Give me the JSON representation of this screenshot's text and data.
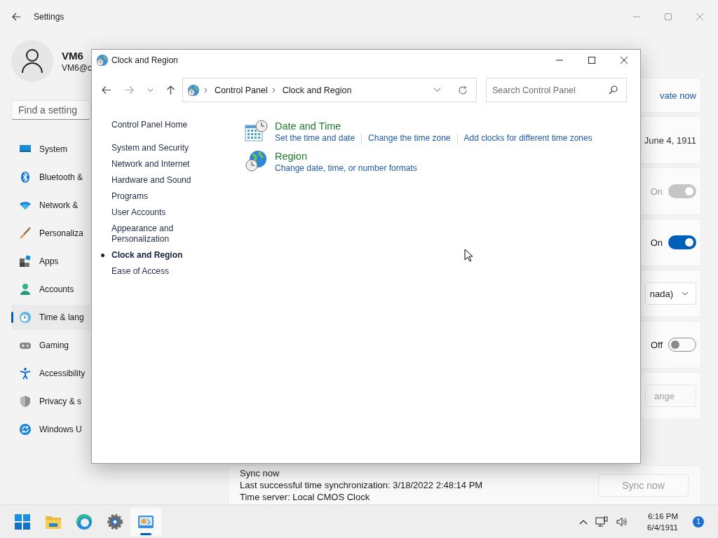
{
  "settings": {
    "title": "Settings",
    "user": {
      "name": "VM6",
      "email": "VM6@c"
    },
    "search": {
      "placeholder": "Find a setting"
    },
    "nav": [
      {
        "label": "System",
        "selected": false
      },
      {
        "label": "Bluetooth &",
        "selected": false
      },
      {
        "label": "Network &",
        "selected": false
      },
      {
        "label": "Personaliza",
        "selected": false
      },
      {
        "label": "Apps",
        "selected": false
      },
      {
        "label": "Accounts",
        "selected": false
      },
      {
        "label": "Time & lang",
        "selected": true
      },
      {
        "label": "Gaming",
        "selected": false
      },
      {
        "label": "Accessibility",
        "selected": false
      },
      {
        "label": "Privacy & s",
        "selected": false
      },
      {
        "label": "Windows U",
        "selected": false
      }
    ],
    "cards": [
      {
        "kind": "link",
        "text": "vate now"
      },
      {
        "kind": "text",
        "text": "June 4, 1911"
      },
      {
        "kind": "toggle",
        "text": "On",
        "on": true,
        "disabled": true
      },
      {
        "kind": "toggle",
        "text": "On",
        "on": true,
        "disabled": false
      },
      {
        "kind": "dropdown",
        "text": "nada)"
      },
      {
        "kind": "toggle",
        "text": "Off",
        "on": false,
        "disabled": false
      },
      {
        "kind": "button",
        "text": "ange",
        "disabled": true
      }
    ],
    "sync": {
      "title": "Sync now",
      "lines": [
        "Last successful time synchronization: 3/18/2022 2:48:14 PM",
        "Time server: Local CMOS Clock"
      ],
      "button": "Sync now",
      "button_disabled": true
    }
  },
  "control_panel": {
    "title": "Clock and Region",
    "breadcrumb": [
      "Control Panel",
      "Clock and Region"
    ],
    "search": {
      "placeholder": "Search Control Panel"
    },
    "sidebar": {
      "home": "Control Panel Home",
      "items": [
        {
          "label": "System and Security",
          "selected": false
        },
        {
          "label": "Network and Internet",
          "selected": false
        },
        {
          "label": "Hardware and Sound",
          "selected": false
        },
        {
          "label": "Programs",
          "selected": false
        },
        {
          "label": "User Accounts",
          "selected": false
        },
        {
          "label": "Appearance and Personalization",
          "selected": false
        },
        {
          "label": "Clock and Region",
          "selected": true
        },
        {
          "label": "Ease of Access",
          "selected": false
        }
      ]
    },
    "categories": [
      {
        "title": "Date and Time",
        "links": [
          "Set the time and date",
          "Change the time zone",
          "Add clocks for different time zones"
        ]
      },
      {
        "title": "Region",
        "links": [
          "Change date, time, or number formats"
        ]
      }
    ]
  },
  "taskbar": {
    "apps": [
      {
        "selected": false
      },
      {
        "selected": false
      },
      {
        "selected": false
      },
      {
        "selected": false
      },
      {
        "selected": true
      }
    ],
    "time": "6:16 PM",
    "date": "6/4/1911",
    "notifications": "1"
  }
}
